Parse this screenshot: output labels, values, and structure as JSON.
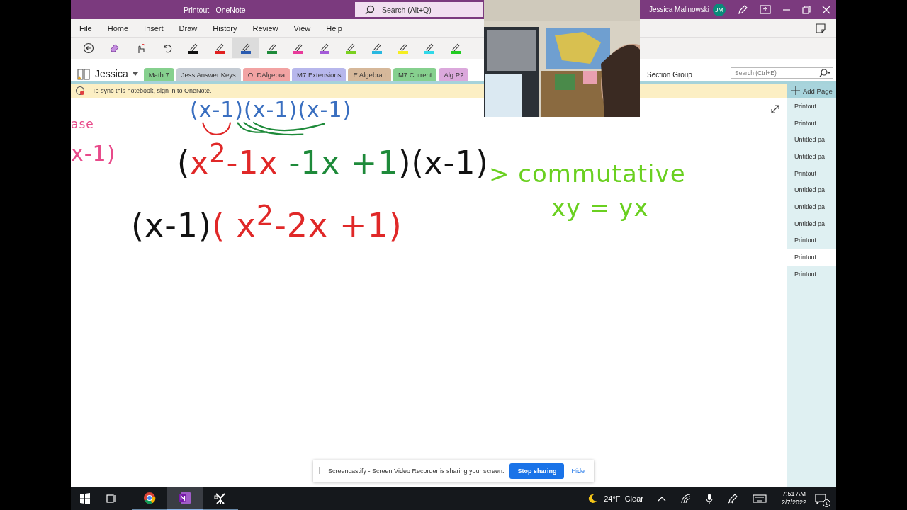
{
  "window": {
    "title": "Printout  -  OneNote",
    "search_placeholder": "Search (Alt+Q)",
    "user": "Jessica Malinowski",
    "avatar": "JM"
  },
  "menu": [
    "File",
    "Home",
    "Insert",
    "Draw",
    "History",
    "Review",
    "View",
    "Help"
  ],
  "toolbar": [
    {
      "kind": "back",
      "selected": false
    },
    {
      "kind": "eraser",
      "selected": false
    },
    {
      "kind": "lasso",
      "selected": false
    },
    {
      "kind": "undo",
      "selected": false
    },
    {
      "kind": "pen",
      "color": "#111111",
      "selected": false
    },
    {
      "kind": "pen",
      "color": "#e02020",
      "selected": false
    },
    {
      "kind": "pen",
      "color": "#2a5bb0",
      "selected": true
    },
    {
      "kind": "pen",
      "color": "#1e8a3a",
      "selected": false
    },
    {
      "kind": "pen",
      "color": "#e83a9a",
      "selected": false
    },
    {
      "kind": "pen",
      "color": "#a45ad8",
      "selected": false
    },
    {
      "kind": "pen",
      "color": "#7ad020",
      "selected": false
    },
    {
      "kind": "pen",
      "color": "#29b8e0",
      "selected": false
    },
    {
      "kind": "pen",
      "color": "#f5ee20",
      "selected": false
    },
    {
      "kind": "pen",
      "color": "#30d8e8",
      "selected": false
    },
    {
      "kind": "pen",
      "color": "#22cc22",
      "selected": false
    }
  ],
  "notebook": {
    "name": "Jessica"
  },
  "sections": [
    {
      "label": "Math 7",
      "color": "#86d08e"
    },
    {
      "label": "Jess Answer Keys",
      "color": "#c5ccd4"
    },
    {
      "label": "OLDAlgebra",
      "color": "#f2a3a3"
    },
    {
      "label": "M7 Extensions",
      "color": "#b7b7ec"
    },
    {
      "label": "E Algebra I",
      "color": "#d6b89a"
    },
    {
      "label": "M7 Current",
      "color": "#86d08e"
    },
    {
      "label": "Alg P2",
      "color": "#dba8dc"
    }
  ],
  "section_group": "Section Group",
  "notebook_search_placeholder": "Search (Ctrl+E)",
  "sync_notice": "To sync this notebook, sign in to OneNote.",
  "add_page": "Add Page",
  "pages": [
    {
      "title": "Printout",
      "selected": false
    },
    {
      "title": "Printout",
      "selected": false
    },
    {
      "title": "Untitled pa",
      "selected": false
    },
    {
      "title": "Untitled pa",
      "selected": false
    },
    {
      "title": "Printout",
      "selected": false
    },
    {
      "title": "Untitled pa",
      "selected": false
    },
    {
      "title": "Untitled pa",
      "selected": false
    },
    {
      "title": "Untitled pa",
      "selected": false
    },
    {
      "title": "Printout",
      "selected": false
    },
    {
      "title": "Printout",
      "selected": true
    },
    {
      "title": "Printout",
      "selected": false
    }
  ],
  "ink": [
    {
      "segments": [
        {
          "text": "(x-1)(x-1)(x-1)",
          "color": "#3a6fc0"
        }
      ]
    },
    {
      "segments": [
        {
          "text": "(",
          "color": "#111111"
        },
        {
          "text": "x$^{2}$-1x",
          "color": "#e02828"
        },
        {
          "text": " -1x +1",
          "color": "#1e8a3a"
        },
        {
          "text": ")(x-1)",
          "color": "#111111"
        }
      ]
    },
    {
      "segments": [
        {
          "text": "(x-1)",
          "color": "#111111"
        },
        {
          "text": "( x$^{2}$-2x +1)",
          "color": "#e02828"
        }
      ]
    },
    {
      "segments": [
        {
          "text": "ase",
          "color": "#e84a8a"
        }
      ]
    },
    {
      "segments": [
        {
          "text": "x-1)",
          "color": "#e84a8a"
        }
      ]
    },
    {
      "segments": [
        {
          "text": "> commutative",
          "color": "#6ad020"
        }
      ]
    },
    {
      "segments": [
        {
          "text": "xy = yx",
          "color": "#6ad020"
        }
      ]
    }
  ],
  "share_bar": {
    "message": "Screencastify - Screen Video Recorder is sharing your screen.",
    "stop": "Stop sharing",
    "hide": "Hide"
  },
  "taskbar": {
    "apps": [
      {
        "kind": "chrome",
        "active": false
      },
      {
        "kind": "onenote",
        "active": true
      },
      {
        "kind": "screencastify",
        "active": false
      }
    ],
    "weather": "24°F  Clear",
    "time": "7:51 AM",
    "date": "2/7/2022",
    "notifications": "1"
  }
}
